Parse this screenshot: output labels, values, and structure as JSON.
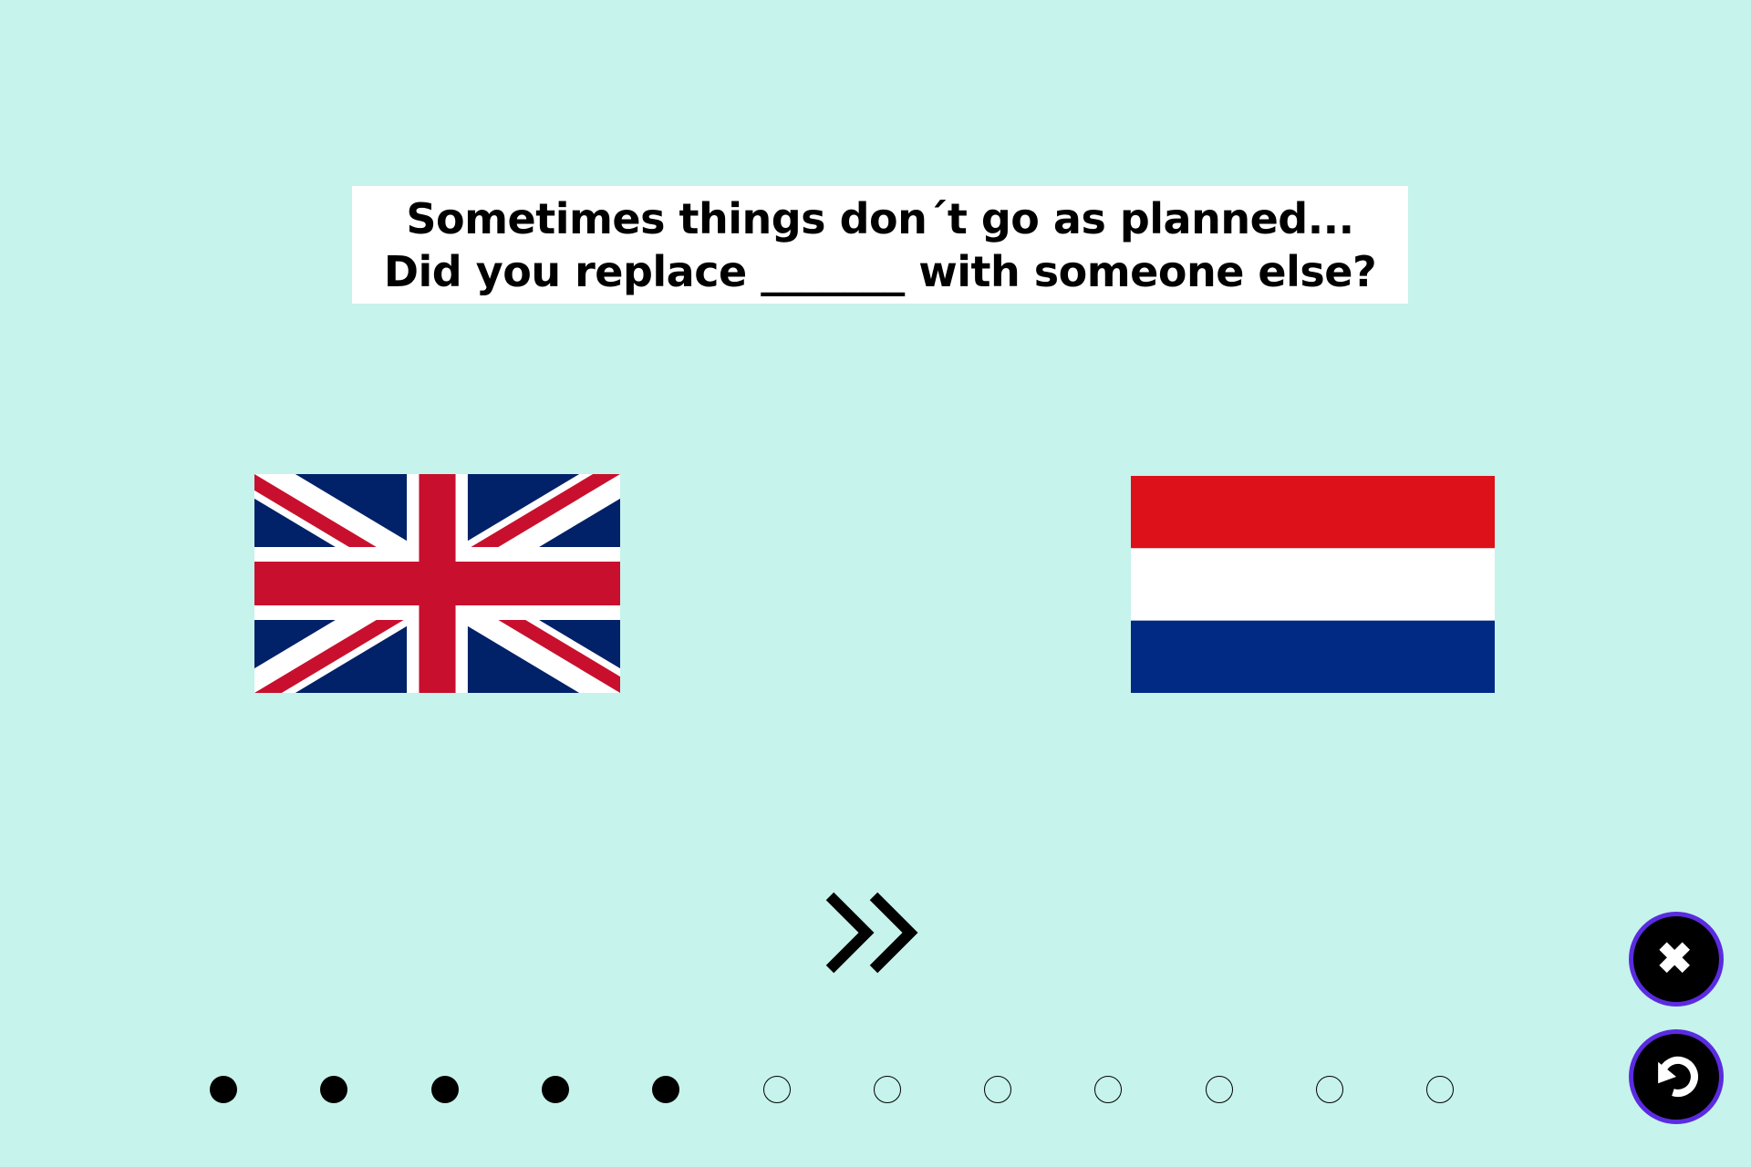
{
  "question": {
    "line1": "Sometimes things don´t go as planned...",
    "line2": "Did you replace _______ with someone else?"
  },
  "options": [
    {
      "id": "uk",
      "icon": "uk-flag-icon"
    },
    {
      "id": "nl",
      "icon": "netherlands-flag-icon"
    }
  ],
  "controls": {
    "next_icon": "double-chevron-right-icon",
    "close_icon": "close-icon",
    "restart_icon": "restart-icon"
  },
  "progress": {
    "total": 12,
    "completed": 5
  },
  "colors": {
    "background": "#c6f3ec",
    "button_ring": "#5b2be0",
    "uk_blue": "#012169",
    "uk_red": "#c8102e",
    "nl_red": "#dd1119",
    "nl_blue": "#012a85"
  }
}
